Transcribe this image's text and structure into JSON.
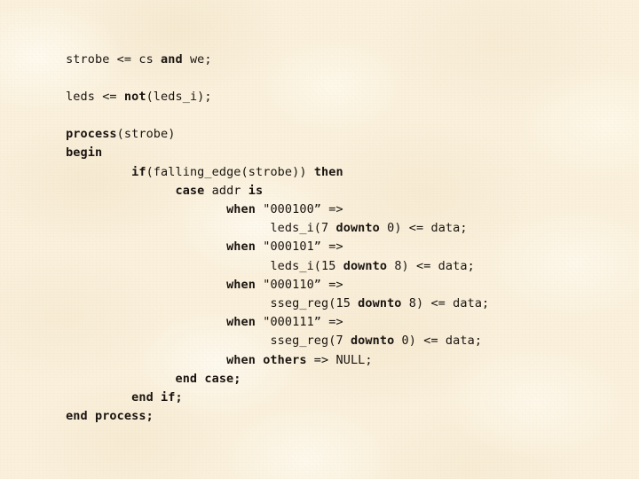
{
  "slide": {
    "kind": "presentation-slide",
    "background_color": "#faf0dc",
    "text_color": "#1a1410",
    "language": "VHDL",
    "font_style": "monospace",
    "indent_unit_spaces": 4
  },
  "code": {
    "lines": [
      {
        "id": "line-strobe-assign",
        "indent": 0,
        "text": "strobe <= cs and we;",
        "tokens": [
          {
            "t": "strobe <= cs ",
            "bold": false
          },
          {
            "t": "and",
            "bold": true
          },
          {
            "t": " we;",
            "bold": false
          }
        ]
      },
      {
        "id": "line-blank-1",
        "indent": 0,
        "text": "",
        "tokens": []
      },
      {
        "id": "line-leds-assign",
        "indent": 0,
        "text": "leds <= not(leds_i);",
        "tokens": [
          {
            "t": "leds <= ",
            "bold": false
          },
          {
            "t": "not",
            "bold": true
          },
          {
            "t": "(leds_i);",
            "bold": false
          }
        ]
      },
      {
        "id": "line-blank-2",
        "indent": 0,
        "text": "",
        "tokens": []
      },
      {
        "id": "line-process-header",
        "indent": 0,
        "text": "process(strobe)",
        "tokens": [
          {
            "t": "process",
            "bold": true
          },
          {
            "t": "(strobe)",
            "bold": false
          }
        ]
      },
      {
        "id": "line-begin",
        "indent": 0,
        "text": "begin",
        "tokens": [
          {
            "t": "begin",
            "bold": true
          }
        ]
      },
      {
        "id": "line-if-falling-edge",
        "indent": 9,
        "text": "if(falling_edge(strobe)) then",
        "tokens": [
          {
            "t": "if",
            "bold": true
          },
          {
            "t": "(falling_edge(strobe)) ",
            "bold": false
          },
          {
            "t": "then",
            "bold": true
          }
        ]
      },
      {
        "id": "line-case-addr",
        "indent": 15,
        "text": "case addr is",
        "tokens": [
          {
            "t": "case",
            "bold": true
          },
          {
            "t": " addr ",
            "bold": false
          },
          {
            "t": "is",
            "bold": true
          }
        ]
      },
      {
        "id": "line-when-000100",
        "indent": 22,
        "text": "when \"000100\" =>",
        "tokens": [
          {
            "t": "when",
            "bold": true
          },
          {
            "t": " \"000100” =>",
            "bold": false
          }
        ]
      },
      {
        "id": "line-leds-i-7-downto-0",
        "indent": 28,
        "text": "leds_i(7 downto 0) <= data;",
        "tokens": [
          {
            "t": "leds_i(7 ",
            "bold": false
          },
          {
            "t": "downto",
            "bold": true
          },
          {
            "t": " 0) <= data;",
            "bold": false
          }
        ]
      },
      {
        "id": "line-when-000101",
        "indent": 22,
        "text": "when \"000101\" =>",
        "tokens": [
          {
            "t": "when",
            "bold": true
          },
          {
            "t": " \"000101” =>",
            "bold": false
          }
        ]
      },
      {
        "id": "line-leds-i-15-downto-8",
        "indent": 28,
        "text": "leds_i(15 downto 8) <= data;",
        "tokens": [
          {
            "t": "leds_i(15 ",
            "bold": false
          },
          {
            "t": "downto",
            "bold": true
          },
          {
            "t": " 8) <= data;",
            "bold": false
          }
        ]
      },
      {
        "id": "line-when-000110",
        "indent": 22,
        "text": "when \"000110\" =>",
        "tokens": [
          {
            "t": "when",
            "bold": true
          },
          {
            "t": " \"000110” =>",
            "bold": false
          }
        ]
      },
      {
        "id": "line-sseg-reg-15-downto-8",
        "indent": 28,
        "text": "sseg_reg(15 downto 8) <= data;",
        "tokens": [
          {
            "t": "sseg_reg(15 ",
            "bold": false
          },
          {
            "t": "downto",
            "bold": true
          },
          {
            "t": " 8) <= data;",
            "bold": false
          }
        ]
      },
      {
        "id": "line-when-000111",
        "indent": 22,
        "text": "when \"000111\" =>",
        "tokens": [
          {
            "t": "when",
            "bold": true
          },
          {
            "t": " \"000111” =>",
            "bold": false
          }
        ]
      },
      {
        "id": "line-sseg-reg-7-downto-0",
        "indent": 28,
        "text": "sseg_reg(7 downto 0) <= data;",
        "tokens": [
          {
            "t": "sseg_reg(7 ",
            "bold": false
          },
          {
            "t": "downto",
            "bold": true
          },
          {
            "t": " 0) <= data;",
            "bold": false
          }
        ]
      },
      {
        "id": "line-when-others",
        "indent": 22,
        "text": "when others => NULL;",
        "tokens": [
          {
            "t": "when others",
            "bold": true
          },
          {
            "t": " => NULL;",
            "bold": false
          }
        ]
      },
      {
        "id": "line-end-case",
        "indent": 15,
        "text": "end case;",
        "tokens": [
          {
            "t": "end case;",
            "bold": true
          }
        ]
      },
      {
        "id": "line-end-if",
        "indent": 9,
        "text": "end if;",
        "tokens": [
          {
            "t": "end if;",
            "bold": true
          }
        ]
      },
      {
        "id": "line-end-process",
        "indent": 0,
        "text": "end process;",
        "tokens": [
          {
            "t": "end process;",
            "bold": true
          }
        ]
      }
    ]
  }
}
